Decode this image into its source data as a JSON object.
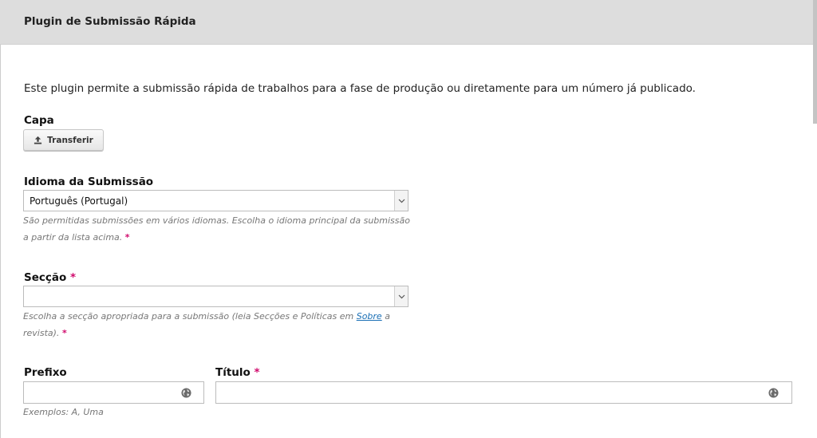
{
  "header": {
    "title": "Plugin de Submissão Rápida"
  },
  "intro": "Este plugin permite a submissão rápida de trabalhos para a fase de produção ou diretamente para um número já publicado.",
  "cover": {
    "label": "Capa",
    "upload_button": "Transferir",
    "icon": "upload-icon"
  },
  "language": {
    "label": "Idioma da Submissão",
    "selected": "Português (Portugal)",
    "help": "São permitidas submissões em vários idiomas. Escolha o idioma principal da submissão a partir da lista acima.",
    "required_mark": "*"
  },
  "section": {
    "label": "Secção",
    "required_mark": "*",
    "selected": "",
    "help_before": "Escolha a secção apropriada para a submissão (leia Secções e Políticas em",
    "help_link": "Sobre",
    "help_after": "a revista).",
    "help_required_mark": "*"
  },
  "prefix": {
    "label": "Prefixo",
    "value": "",
    "help": "Exemplos: A, Uma",
    "icon": "globe-icon"
  },
  "title": {
    "label": "Título",
    "required_mark": "*",
    "value": "",
    "icon": "globe-icon"
  },
  "colors": {
    "header_bg": "#dddddd",
    "required": "#d00a6c",
    "link": "#1a6fb5"
  }
}
